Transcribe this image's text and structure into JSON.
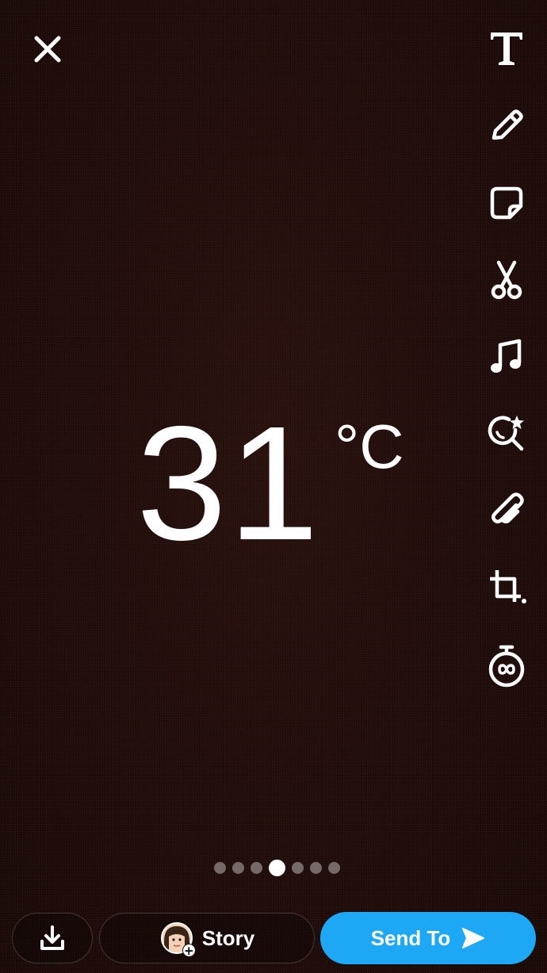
{
  "app": {
    "screen": "snap-preview"
  },
  "top": {
    "close_icon": "close-icon"
  },
  "toolbar": {
    "items": [
      {
        "name": "text-tool",
        "icon": "text-icon"
      },
      {
        "name": "draw-tool",
        "icon": "pencil-icon"
      },
      {
        "name": "sticker-tool",
        "icon": "sticker-icon"
      },
      {
        "name": "scissors-tool",
        "icon": "scissors-icon"
      },
      {
        "name": "music-tool",
        "icon": "music-note-icon"
      },
      {
        "name": "lens-tool",
        "icon": "lens-sparkle-icon"
      },
      {
        "name": "attach-link-tool",
        "icon": "paperclip-icon"
      },
      {
        "name": "crop-tool",
        "icon": "crop-icon"
      },
      {
        "name": "timer-tool",
        "icon": "infinity-timer-icon"
      }
    ]
  },
  "filter": {
    "temperature": "31",
    "unit": "°C"
  },
  "pager": {
    "count": 7,
    "active_index": 3
  },
  "bottom": {
    "save_icon": "download-icon",
    "story_label": "Story",
    "send_label": "Send To",
    "send_color": "#1ea7f4"
  }
}
